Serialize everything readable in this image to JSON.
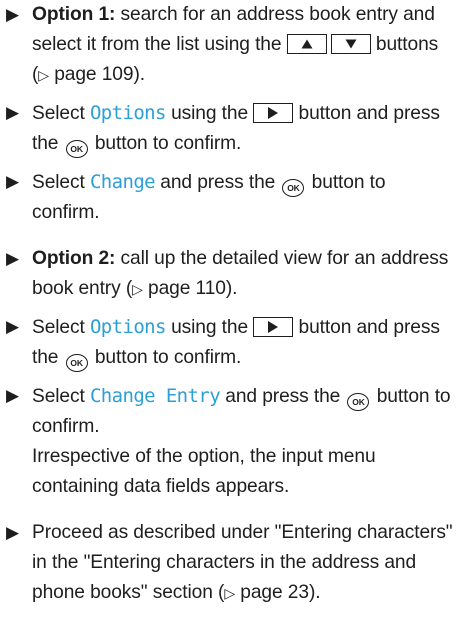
{
  "steps": [
    {
      "bold": "Option 1:",
      "t1": " search for an address book entry and select it from the list using the ",
      "btn_up": "▲",
      "btn_down": "▼",
      "t2": " buttons (",
      "pageref": "page 109",
      "t3": ")."
    },
    {
      "t1": "Select ",
      "display": "Options",
      "t2": " using the ",
      "btn_right": "▶",
      "t3": " button and press the ",
      "ok": "OK",
      "t4": " button to confirm."
    },
    {
      "t1": "Select ",
      "display": "Change",
      "t2": " and press the ",
      "ok": "OK",
      "t3": " button to confirm."
    },
    {
      "bold": "Option 2:",
      "t1": " call up the detailed view for an address book entry (",
      "pageref": "page 110",
      "t2": ")."
    },
    {
      "t1": "Select ",
      "display": "Options",
      "t2": " using the ",
      "btn_right": "▶",
      "t3": " button and press the ",
      "ok": "OK",
      "t4": " button to confirm."
    },
    {
      "t1": "Select ",
      "display": "Change Entry",
      "t2": " and press the ",
      "ok": "OK",
      "t3": " button to confirm.",
      "result": "Irrespective of the option, the input menu containing data fields appears."
    },
    {
      "t1": "Proceed as described under \"Entering characters\" in the \"Entering characters in the address and phone books\" section (",
      "pageref": "page 23",
      "t2": ")."
    }
  ],
  "symbols": {
    "step_arrow": "▶",
    "pageref_arrow": "▷"
  },
  "colors": {
    "display_text": "#2c9fd6",
    "body_text": "#1e1e1e"
  }
}
